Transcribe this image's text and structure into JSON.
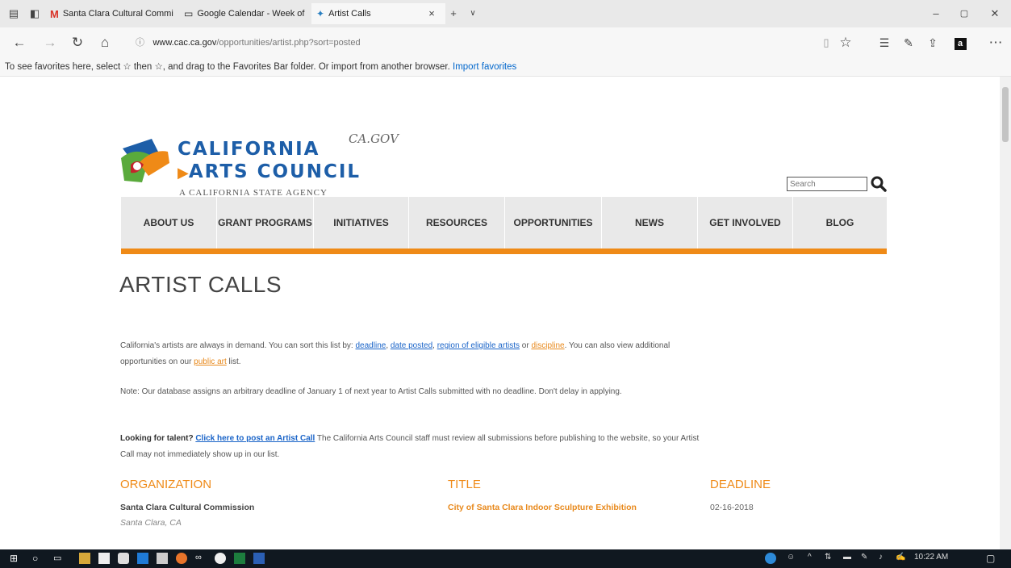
{
  "browser": {
    "tabs": [
      {
        "title": "Santa Clara Cultural Commi",
        "icon": "gmail-icon"
      },
      {
        "title": "Google Calendar - Week of",
        "icon": "calendar-icon"
      },
      {
        "title": "Artist Calls",
        "icon": "cac-favicon",
        "active": true
      }
    ],
    "url_host": "www.cac.ca.gov",
    "url_path": "/opportunities/artist.php?sort=posted",
    "favorites_message": "To see favorites here, select ☆ then ☆, and drag to the Favorites Bar folder. Or import from another browser.",
    "import_link": "Import favorites"
  },
  "header": {
    "logo_line1": "CALIFORNIA",
    "logo_line2": "ARTS COUNCIL",
    "logo_line3": "A CALIFORNIA STATE AGENCY",
    "ca_gov_mark": "CA.GOV",
    "search_placeholder": "Search"
  },
  "nav": [
    "ABOUT US",
    "GRANT PROGRAMS",
    "INITIATIVES",
    "RESOURCES",
    "OPPORTUNITIES",
    "NEWS",
    "GET INVOLVED",
    "BLOG"
  ],
  "main": {
    "title": "ARTIST CALLS",
    "intro_1": "California's artists are always in demand. You can sort this list by: ",
    "link_deadline": "deadline",
    "sep_comma": ", ",
    "link_date_posted": "date posted",
    "link_region": "region of eligible artists",
    "word_or": " or ",
    "link_discipline": "discipline",
    "intro_2": ". You can also view additional opportunities on our ",
    "link_public_art": "public art",
    "intro_3": " list.",
    "note": "Note: Our database assigns an arbitrary deadline of January 1 of next year to Artist Calls submitted with no deadline. Don't delay in applying.",
    "looking_label": "Looking for talent?",
    "post_link": "Click here to post an Artist Call",
    "looking_rest": " The California Arts Council staff must review all submissions before publishing to the website, so your Artist Call may not immediately show up in our list."
  },
  "table": {
    "headers": [
      "ORGANIZATION",
      "TITLE",
      "DEADLINE"
    ],
    "rows": [
      {
        "organization": "Santa Clara Cultural Commission",
        "location": "Santa Clara, CA",
        "title": "City of Santa Clara Indoor Sculpture Exhibition",
        "deadline": "02-16-2018"
      }
    ]
  },
  "taskbar": {
    "clock": "10:22 AM"
  },
  "colors": {
    "orange": "#ef8a17",
    "logo_blue": "#1d5ea8",
    "nav_gray": "#e9e9e9",
    "link_blue": "#1a64c8"
  }
}
